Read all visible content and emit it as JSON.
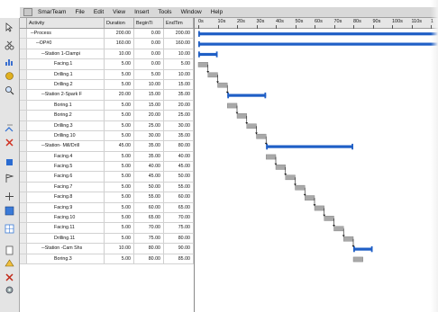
{
  "menu": {
    "items": [
      "SmarTeam",
      "File",
      "Edit",
      "View",
      "Insert",
      "Tools",
      "Window",
      "Help"
    ]
  },
  "grid": {
    "columns": [
      "Activity",
      "Duration",
      "BeginTi",
      "EndTim"
    ],
    "rows": [
      {
        "name": "Process",
        "duration": "200.00",
        "begin": "0.00",
        "end": "200.00",
        "level": 0,
        "summary": true
      },
      {
        "name": "OP#0",
        "duration": "160.00",
        "begin": "0.00",
        "end": "160.00",
        "level": 1,
        "summary": true
      },
      {
        "name": "Station 1-Clampi",
        "duration": "10.00",
        "begin": "0.00",
        "end": "10.00",
        "level": 2,
        "summary": true
      },
      {
        "name": "Facing.1",
        "duration": "5.00",
        "begin": "0.00",
        "end": "5.00",
        "level": 3
      },
      {
        "name": "Drilling.1",
        "duration": "5.00",
        "begin": "5.00",
        "end": "10.00",
        "level": 3
      },
      {
        "name": "Drilling.2",
        "duration": "5.00",
        "begin": "10.00",
        "end": "15.00",
        "level": 3
      },
      {
        "name": "Station 2-Spark F",
        "duration": "20.00",
        "begin": "15.00",
        "end": "35.00",
        "level": 2,
        "summary": true
      },
      {
        "name": "Boring.1",
        "duration": "5.00",
        "begin": "15.00",
        "end": "20.00",
        "level": 3
      },
      {
        "name": "Boring.2",
        "duration": "5.00",
        "begin": "20.00",
        "end": "25.00",
        "level": 3
      },
      {
        "name": "Drilling.3",
        "duration": "5.00",
        "begin": "25.00",
        "end": "30.00",
        "level": 3
      },
      {
        "name": "Drilling.10",
        "duration": "5.00",
        "begin": "30.00",
        "end": "35.00",
        "level": 3
      },
      {
        "name": "Station- Mill/Drill",
        "duration": "45.00",
        "begin": "35.00",
        "end": "80.00",
        "level": 2,
        "summary": true
      },
      {
        "name": "Facing.4",
        "duration": "5.00",
        "begin": "35.00",
        "end": "40.00",
        "level": 3
      },
      {
        "name": "Facing.5",
        "duration": "5.00",
        "begin": "40.00",
        "end": "45.00",
        "level": 3
      },
      {
        "name": "Facing.6",
        "duration": "5.00",
        "begin": "45.00",
        "end": "50.00",
        "level": 3
      },
      {
        "name": "Facing.7",
        "duration": "5.00",
        "begin": "50.00",
        "end": "55.00",
        "level": 3
      },
      {
        "name": "Facing.8",
        "duration": "5.00",
        "begin": "55.00",
        "end": "60.00",
        "level": 3
      },
      {
        "name": "Facing.9",
        "duration": "5.00",
        "begin": "60.00",
        "end": "65.00",
        "level": 3
      },
      {
        "name": "Facing.10",
        "duration": "5.00",
        "begin": "65.00",
        "end": "70.00",
        "level": 3
      },
      {
        "name": "Facing.11",
        "duration": "5.00",
        "begin": "70.00",
        "end": "75.00",
        "level": 3
      },
      {
        "name": "Drilling.11",
        "duration": "5.00",
        "begin": "75.00",
        "end": "80.00",
        "level": 3
      },
      {
        "name": "Station -Cam Shs",
        "duration": "10.00",
        "begin": "80.00",
        "end": "90.00",
        "level": 2,
        "summary": true
      },
      {
        "name": "Boring.3",
        "duration": "5.00",
        "begin": "80.00",
        "end": "85.00",
        "level": 3
      }
    ]
  },
  "timeline": {
    "ticks": [
      "0s",
      "10s",
      "20s",
      "30s",
      "40s",
      "50s",
      "60s",
      "70s",
      "80s",
      "90s",
      "100s",
      "110s",
      "1"
    ]
  },
  "colors": {
    "summary_bar": "#1f5fc6",
    "task_bar": "#a9a9a9",
    "link": "#111111"
  },
  "icons": [
    "select-icon",
    "cut-icon",
    "chart-icon",
    "paint-icon",
    "zoom-icon",
    "link-icon",
    "delete-icon",
    "node-icon",
    "flag-icon",
    "move-icon",
    "color-icon",
    "grid-icon",
    "page-icon",
    "shape-icon",
    "cross-icon",
    "gear-icon"
  ]
}
